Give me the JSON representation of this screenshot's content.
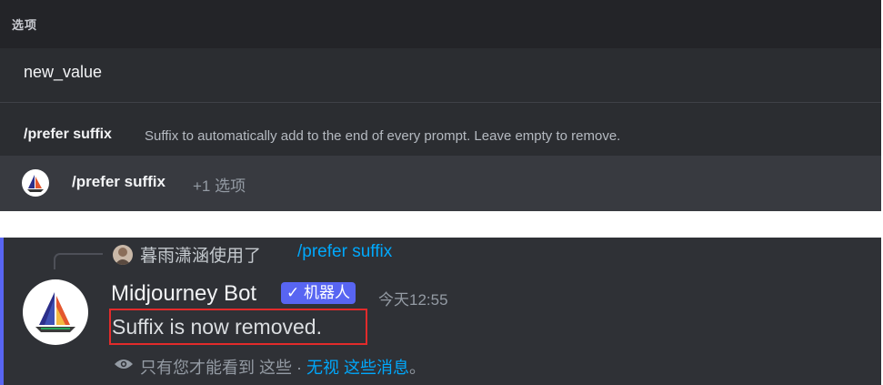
{
  "options_panel": {
    "title": "选项",
    "option_value": "new_value",
    "hint_command": "/prefer suffix",
    "hint_description": "Suffix to automatically add to the end of every prompt. Leave empty to remove.",
    "input_command": "/prefer suffix",
    "input_extra": "+1 选项"
  },
  "message": {
    "reply_user": "暮雨潇涵使用了",
    "reply_command": "/prefer suffix",
    "bot_name": "Midjourney Bot",
    "bot_badge": "✓ 机器人",
    "timestamp": "今天12:55",
    "text": "Suffix is now removed.",
    "ephemeral_prefix": "只有您才能看到 这些 · ",
    "ephemeral_link": "无视 这些消息",
    "ephemeral_suffix": "。"
  },
  "colors": {
    "accent": "#5865f2",
    "link": "#00a8fc",
    "highlight": "#e22b2b"
  },
  "icons": {
    "bot_avatar": "midjourney-sailboat-logo",
    "eye": "eye-icon"
  }
}
